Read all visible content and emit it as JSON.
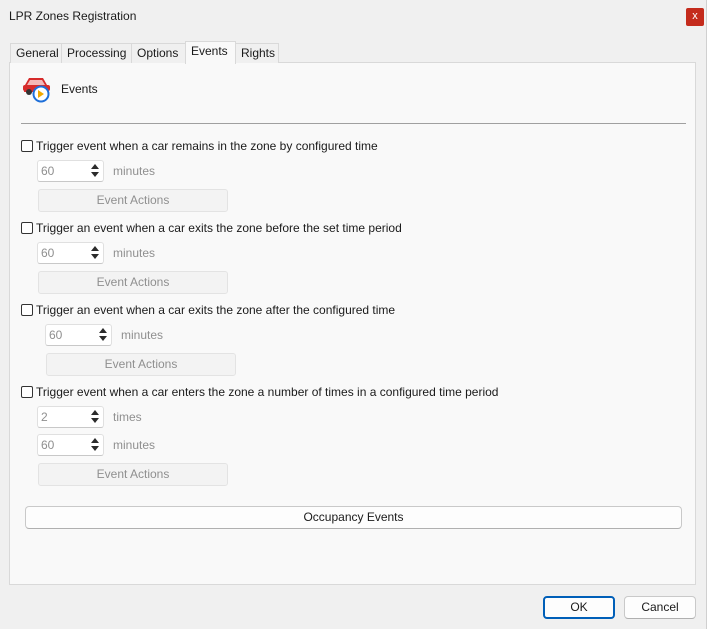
{
  "window": {
    "title": "LPR Zones Registration",
    "close_glyph": "x"
  },
  "tabs": [
    {
      "label": "General"
    },
    {
      "label": "Processing"
    },
    {
      "label": "Options"
    },
    {
      "label": "Events",
      "active": true
    },
    {
      "label": "Rights"
    }
  ],
  "header": {
    "label": "Events",
    "icon": "car-event-icon"
  },
  "triggers": [
    {
      "label": "Trigger event when a car remains in the zone by configured time",
      "checked": false,
      "value": "60",
      "unit": "minutes",
      "action_label": "Event Actions"
    },
    {
      "label": "Trigger an event when a car exits the zone before the set time period",
      "checked": false,
      "value": "60",
      "unit": "minutes",
      "action_label": "Event Actions"
    },
    {
      "label": "Trigger an event when a car exits the zone after the configured time",
      "checked": false,
      "value": "60",
      "unit": "minutes",
      "action_label": "Event Actions"
    },
    {
      "label": "Trigger event when a car enters the zone a number of times in a configured time period",
      "checked": false,
      "count_value": "2",
      "count_unit": "times",
      "value": "60",
      "unit": "minutes",
      "action_label": "Event Actions"
    }
  ],
  "occupancy_label": "Occupancy Events",
  "footer": {
    "ok_label": "OK",
    "cancel_label": "Cancel"
  },
  "colors": {
    "accent": "#005fb8",
    "close": "#c42b1c",
    "icon_red": "#d62b2b",
    "icon_blue": "#1e6fd9"
  }
}
